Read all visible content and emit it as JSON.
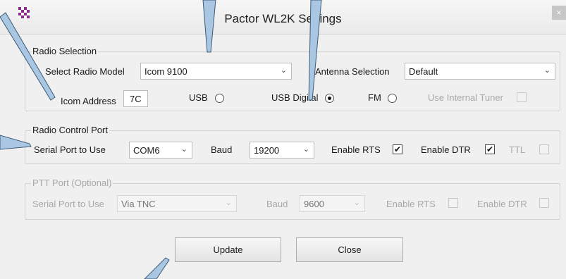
{
  "window": {
    "title": "Pactor WL2K Settings",
    "close_glyph": "×"
  },
  "radio_selection": {
    "label": "Radio Selection",
    "model_label": "Select Radio Model",
    "model_value": "Icom 9100",
    "antenna_label": "Antenna Selection",
    "antenna_value": "Default",
    "icom_address_label": "Icom Address",
    "icom_address_value": "7C",
    "usb_label": "USB",
    "usb_digital_label": "USB Digital",
    "fm_label": "FM",
    "internal_tuner_label": "Use Internal Tuner",
    "selected_mode": "USB Digital"
  },
  "radio_control_port": {
    "label": "Radio Control Port",
    "serial_label": "Serial Port to Use",
    "serial_value": "COM6",
    "baud_label": "Baud",
    "baud_value": "19200",
    "rts_label": "Enable RTS",
    "rts_checked": true,
    "dtr_label": "Enable DTR",
    "dtr_checked": true,
    "ttl_label": "TTL",
    "ttl_checked": false
  },
  "ptt_port": {
    "label": "PTT Port (Optional)",
    "serial_label": "Serial Port to Use",
    "serial_value": "Via TNC",
    "baud_label": "Baud",
    "baud_value": "9600",
    "rts_label": "Enable RTS",
    "dtr_label": "Enable DTR"
  },
  "buttons": {
    "update": "Update",
    "close": "Close"
  },
  "icons": {
    "app": "checkered-flag-icon",
    "dropdown": "chevron-down-icon",
    "check": "checkmark-icon"
  },
  "colors": {
    "pointer": "#a9c6e2",
    "pointer_stroke": "#3d5a75",
    "app_icon": "#8a2a8a"
  }
}
